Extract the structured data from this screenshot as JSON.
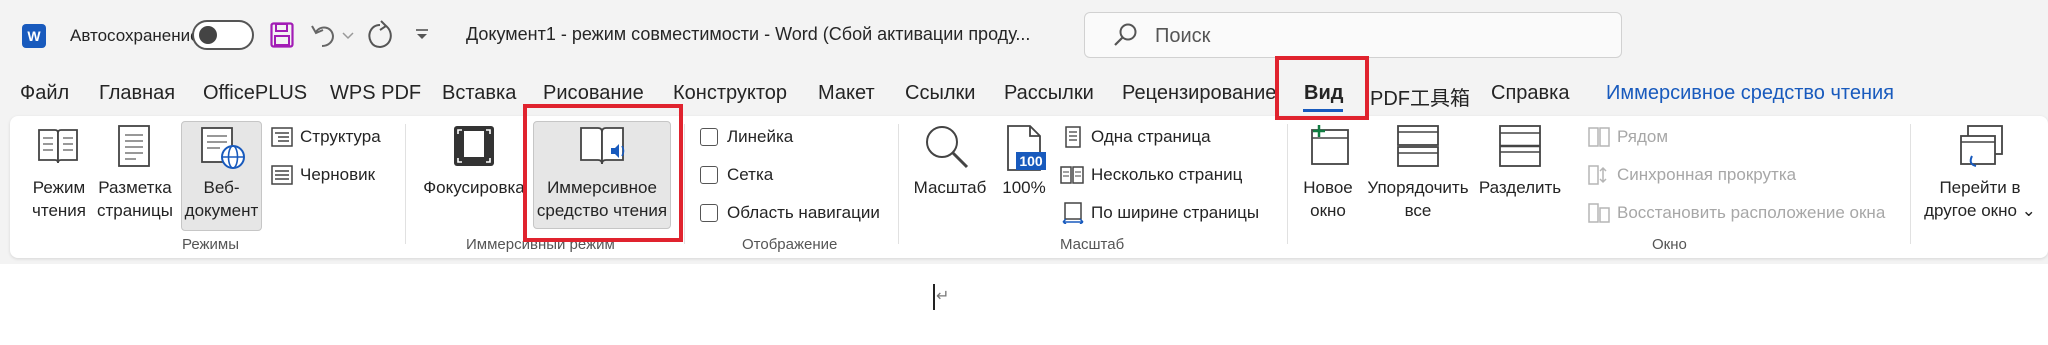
{
  "titlebar": {
    "autosave_label": "Автосохранение",
    "doc_title": "Документ1  -  режим совместимости  -  Word (Сбой активации проду...",
    "search_placeholder": "Поиск"
  },
  "tabs": [
    "Файл",
    "Главная",
    "OfficePLUS",
    "WPS PDF",
    "Вставка",
    "Рисование",
    "Конструктор",
    "Макет",
    "Ссылки",
    "Рассылки",
    "Рецензирование",
    "Вид",
    "PDF工具箱",
    "Справка",
    "Иммерсивное средство чтения"
  ],
  "ribbon": {
    "modes": {
      "read_mode": "Режим\nчтения",
      "print_layout": "Разметка\nстраницы",
      "web_layout": "Веб-\nдокумент",
      "outline": "Структура",
      "draft": "Черновик",
      "group": "Режимы"
    },
    "immersive": {
      "focus": "Фокусировка",
      "immersive_reader": "Иммерсивное\nсредство чтения",
      "group": "Иммерсивный режим"
    },
    "show": {
      "ruler": "Линейка",
      "gridlines": "Сетка",
      "nav_pane": "Область навигации",
      "group": "Отображение"
    },
    "zoom": {
      "zoom": "Масштаб",
      "zoom_100": "100%",
      "badge_100": "100",
      "one_page": "Одна страница",
      "multiple_pages": "Несколько страниц",
      "page_width": "По ширине страницы",
      "group": "Масштаб"
    },
    "window": {
      "new_window": "Новое\nокно",
      "arrange_all": "Упорядочить\nвсе",
      "split": "Разделить",
      "side_by_side": "Рядом",
      "sync_scroll": "Синхронная прокрутка",
      "reset_position": "Восстановить расположение окна",
      "switch_windows": "Перейти в\nдругое окно ⌄",
      "group": "Окно"
    }
  },
  "document": {
    "paragraph_mark": "↵"
  },
  "colors": {
    "accent": "#185abd",
    "highlight": "#e0232e",
    "save_icon": "#a21cb5"
  }
}
